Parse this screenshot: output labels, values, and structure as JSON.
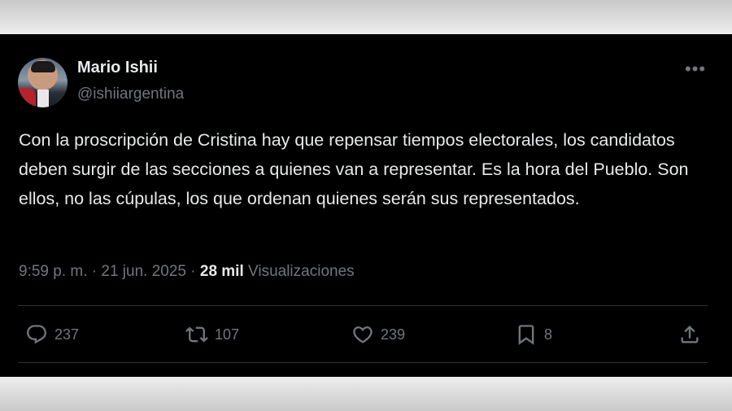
{
  "author": {
    "name": "Mario Ishii",
    "handle": "@ishiiargentina"
  },
  "tweet": {
    "text": "Con la proscripción de Cristina hay que repensar tiempos electorales, los candidatos deben surgir de las secciones a quienes van a representar. Es la hora del Pueblo. Son ellos, no las cúpulas, los que ordenan quienes serán sus representados."
  },
  "meta": {
    "time": "9:59 p. m.",
    "separator": "·",
    "date": "21 jun. 2025",
    "views_count": "28 mil",
    "views_label": "Visualizaciones"
  },
  "actions": {
    "replies": "237",
    "retweets": "107",
    "likes": "239",
    "bookmarks": "8"
  },
  "icons": {
    "more": "more-icon",
    "reply": "reply-icon",
    "retweet": "retweet-icon",
    "like": "heart-icon",
    "bookmark": "bookmark-icon",
    "share": "share-icon"
  },
  "colors": {
    "background": "#000000",
    "text_primary": "#e7e9ea",
    "text_secondary": "#71767b",
    "divider": "#2f3336"
  }
}
